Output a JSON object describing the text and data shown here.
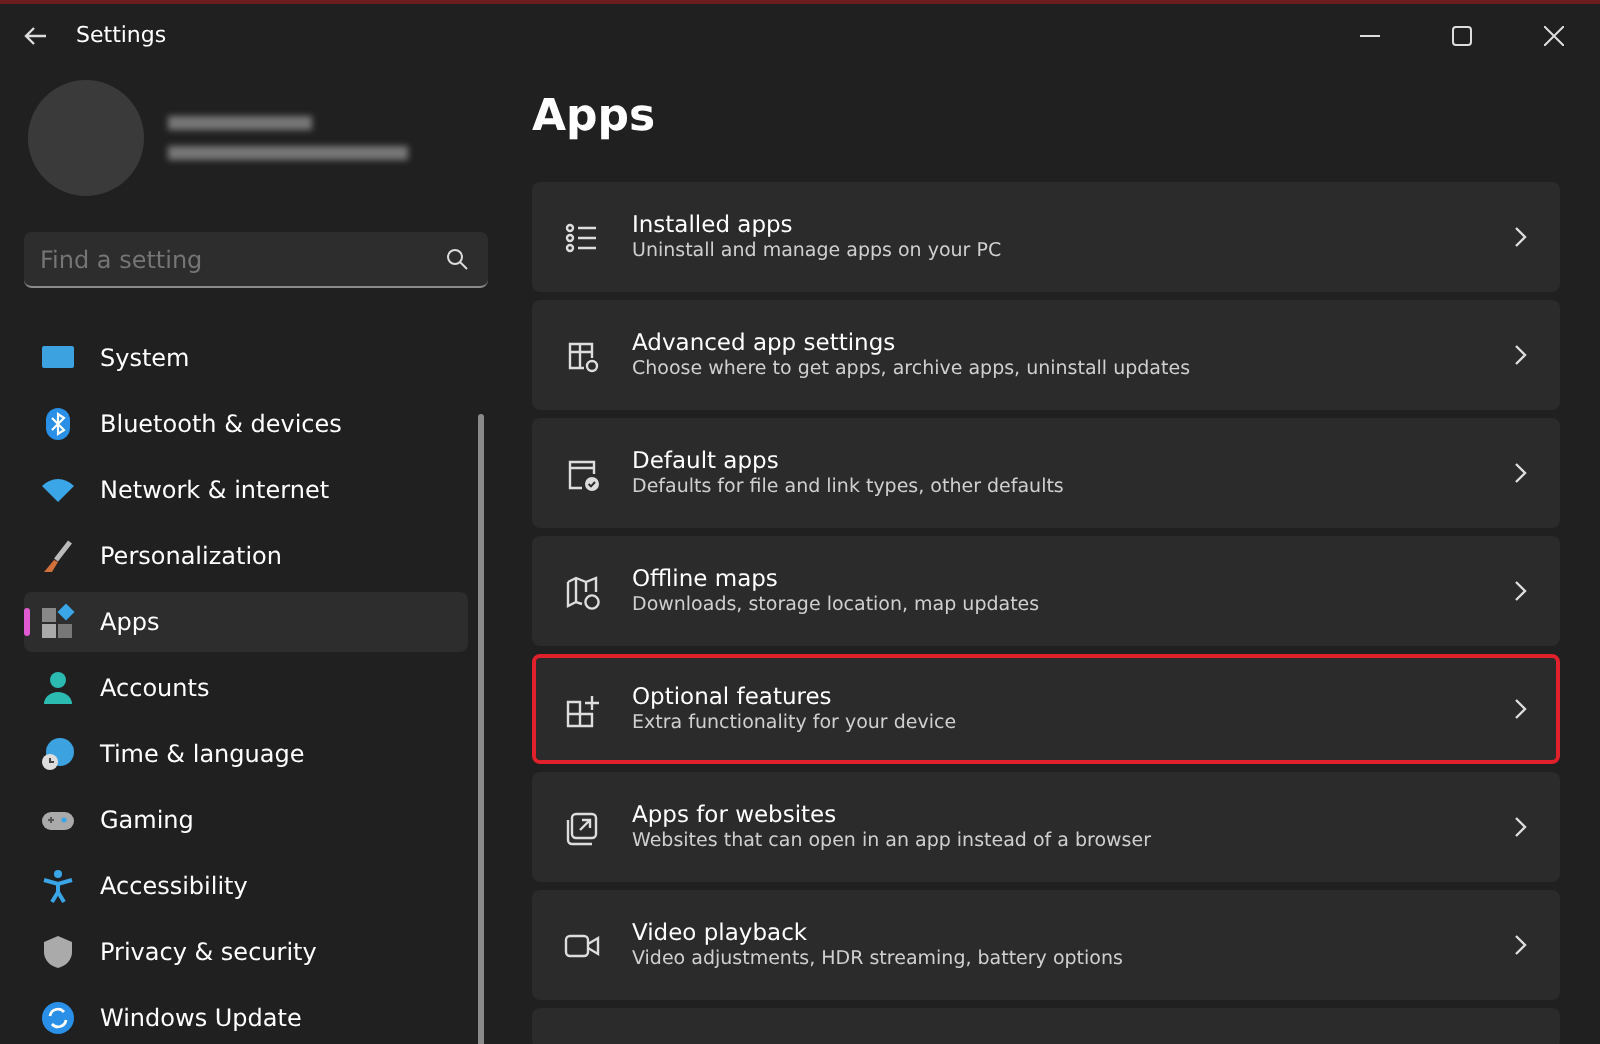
{
  "window": {
    "title": "Settings"
  },
  "search": {
    "placeholder": "Find a setting"
  },
  "sidebar": {
    "items": [
      {
        "label": "System",
        "selected": false
      },
      {
        "label": "Bluetooth & devices",
        "selected": false
      },
      {
        "label": "Network & internet",
        "selected": false
      },
      {
        "label": "Personalization",
        "selected": false
      },
      {
        "label": "Apps",
        "selected": true
      },
      {
        "label": "Accounts",
        "selected": false
      },
      {
        "label": "Time & language",
        "selected": false
      },
      {
        "label": "Gaming",
        "selected": false
      },
      {
        "label": "Accessibility",
        "selected": false
      },
      {
        "label": "Privacy & security",
        "selected": false
      },
      {
        "label": "Windows Update",
        "selected": false
      }
    ]
  },
  "page": {
    "title": "Apps",
    "items": [
      {
        "title": "Installed apps",
        "subtitle": "Uninstall and manage apps on your PC",
        "highlighted": false
      },
      {
        "title": "Advanced app settings",
        "subtitle": "Choose where to get apps, archive apps, uninstall updates",
        "highlighted": false
      },
      {
        "title": "Default apps",
        "subtitle": "Defaults for file and link types, other defaults",
        "highlighted": false
      },
      {
        "title": "Offline maps",
        "subtitle": "Downloads, storage location, map updates",
        "highlighted": false
      },
      {
        "title": "Optional features",
        "subtitle": "Extra functionality for your device",
        "highlighted": true
      },
      {
        "title": "Apps for websites",
        "subtitle": "Websites that can open in an app instead of a browser",
        "highlighted": false
      },
      {
        "title": "Video playback",
        "subtitle": "Video adjustments, HDR streaming, battery options",
        "highlighted": false
      }
    ]
  }
}
